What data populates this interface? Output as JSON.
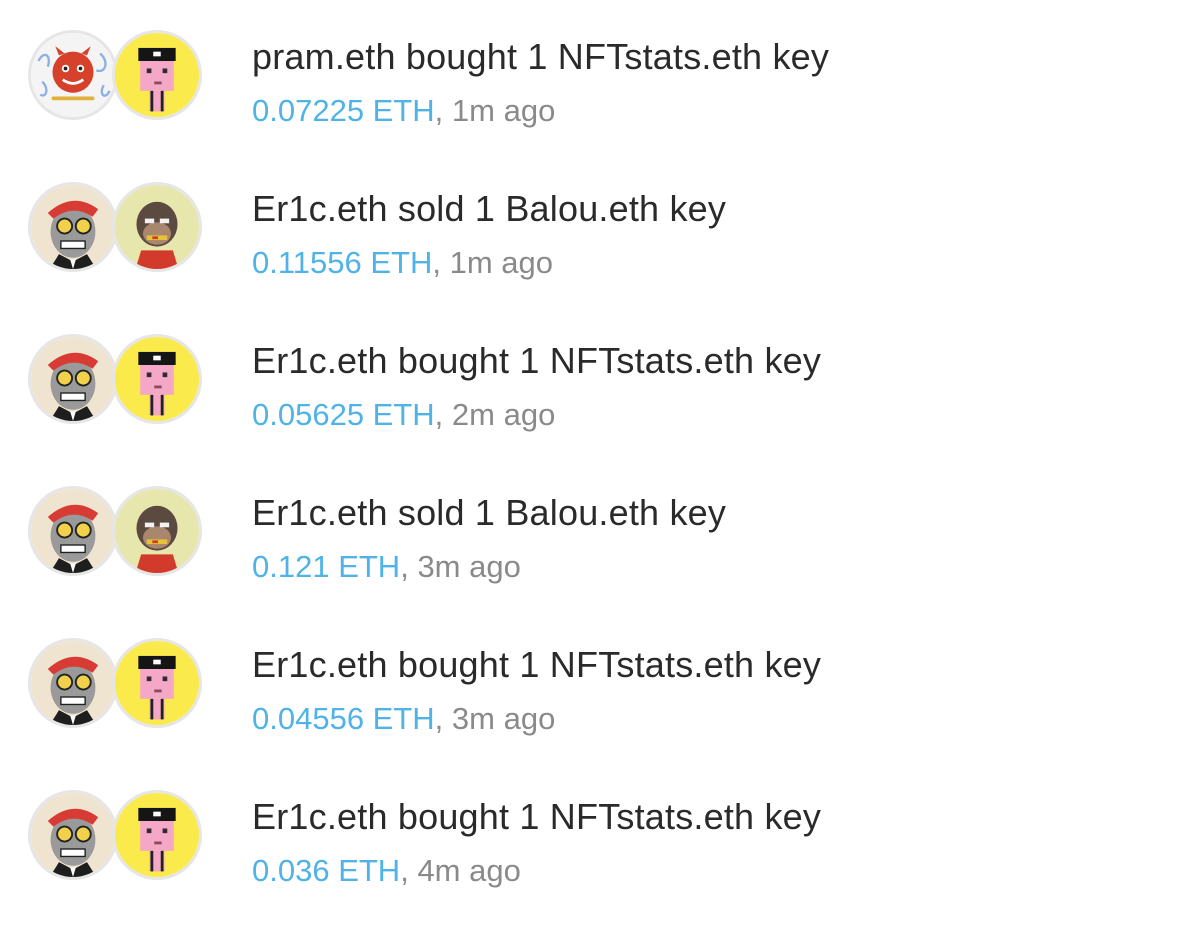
{
  "colors": {
    "price": "#4fb3e8",
    "title": "#2a2a2a",
    "meta": "#8a8a8a"
  },
  "activity": [
    {
      "title": "pram.eth bought 1 NFTstats.eth key",
      "price": "0.07225 ETH",
      "time": "1m ago",
      "sep": ", ",
      "trader_avatar": "red-cat-avatar",
      "subject_avatar": "pixel-punk-avatar"
    },
    {
      "title": "Er1c.eth sold 1 Balou.eth key",
      "price": "0.11556 ETH",
      "time": "1m ago",
      "sep": ", ",
      "trader_avatar": "robot-ape-avatar",
      "subject_avatar": "bored-ape-avatar"
    },
    {
      "title": "Er1c.eth bought 1 NFTstats.eth key",
      "price": "0.05625 ETH",
      "time": "2m ago",
      "sep": ", ",
      "trader_avatar": "robot-ape-avatar",
      "subject_avatar": "pixel-punk-avatar"
    },
    {
      "title": "Er1c.eth sold 1 Balou.eth key",
      "price": "0.121 ETH",
      "time": "3m ago",
      "sep": ", ",
      "trader_avatar": "robot-ape-avatar",
      "subject_avatar": "bored-ape-avatar"
    },
    {
      "title": "Er1c.eth bought 1 NFTstats.eth key",
      "price": "0.04556 ETH",
      "time": "3m ago",
      "sep": ", ",
      "trader_avatar": "robot-ape-avatar",
      "subject_avatar": "pixel-punk-avatar"
    },
    {
      "title": "Er1c.eth bought 1 NFTstats.eth key",
      "price": "0.036 ETH",
      "time": "4m ago",
      "sep": ", ",
      "trader_avatar": "robot-ape-avatar",
      "subject_avatar": "pixel-punk-avatar"
    }
  ]
}
